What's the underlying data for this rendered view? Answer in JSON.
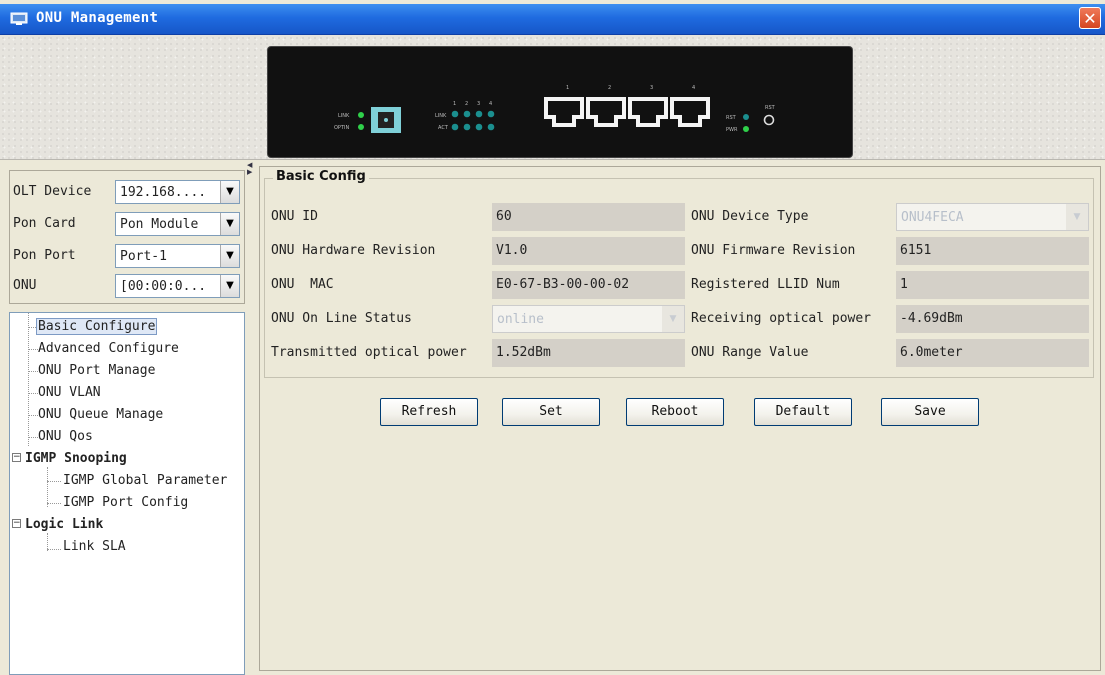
{
  "window": {
    "title": "ONU Management",
    "close_label": "✕"
  },
  "selectors": [
    {
      "label": "OLT Device",
      "value": "192.168...."
    },
    {
      "label": "Pon Card",
      "value": "Pon Module"
    },
    {
      "label": "Pon Port",
      "value": "Port-1"
    },
    {
      "label": "ONU",
      "value": "[00:00:0..."
    }
  ],
  "tree": {
    "items": [
      {
        "label": "Basic Configure",
        "selected": true
      },
      {
        "label": "Advanced Configure"
      },
      {
        "label": "ONU Port Manage"
      },
      {
        "label": "ONU VLAN"
      },
      {
        "label": "ONU Queue Manage"
      },
      {
        "label": "ONU Qos"
      },
      {
        "label": "IGMP Snooping",
        "expanded": true
      },
      {
        "label": "IGMP Global Parameter"
      },
      {
        "label": "IGMP Port Config"
      },
      {
        "label": "Logic Link",
        "expanded": true
      },
      {
        "label": "Link SLA"
      }
    ],
    "expander_symbol": "−"
  },
  "basic_config": {
    "title": "Basic Config",
    "onu_id": {
      "label": "ONU ID",
      "value": "60"
    },
    "device_type": {
      "label": "ONU Device Type",
      "value": "ONU4FECA"
    },
    "hw_rev": {
      "label": "ONU Hardware Revision",
      "value": "V1.0"
    },
    "fw_rev": {
      "label": "ONU Firmware Revision",
      "value": "6151"
    },
    "mac": {
      "label": "ONU  MAC",
      "value": "E0-67-B3-00-00-02"
    },
    "llid": {
      "label": "Registered LLID Num",
      "value": "1"
    },
    "status": {
      "label": "ONU On Line Status",
      "value": "online"
    },
    "rx_power": {
      "label": "Receiving optical power",
      "value": "-4.69dBm"
    },
    "tx_power": {
      "label": "Transmitted optical power",
      "value": "1.52dBm"
    },
    "range": {
      "label": "ONU Range Value",
      "value": "6.0meter"
    }
  },
  "buttons": {
    "refresh": "Refresh",
    "set": "Set",
    "reboot": "Reboot",
    "default": "Default",
    "save": "Save"
  },
  "device_panel": {
    "link": "LINK",
    "optin": "OPTIN",
    "act": "ACT",
    "rst": "RST",
    "pwr": "PWR",
    "led_nums": [
      "1",
      "2",
      "3",
      "4"
    ],
    "port_nums": [
      "1",
      "2",
      "3",
      "4"
    ]
  }
}
